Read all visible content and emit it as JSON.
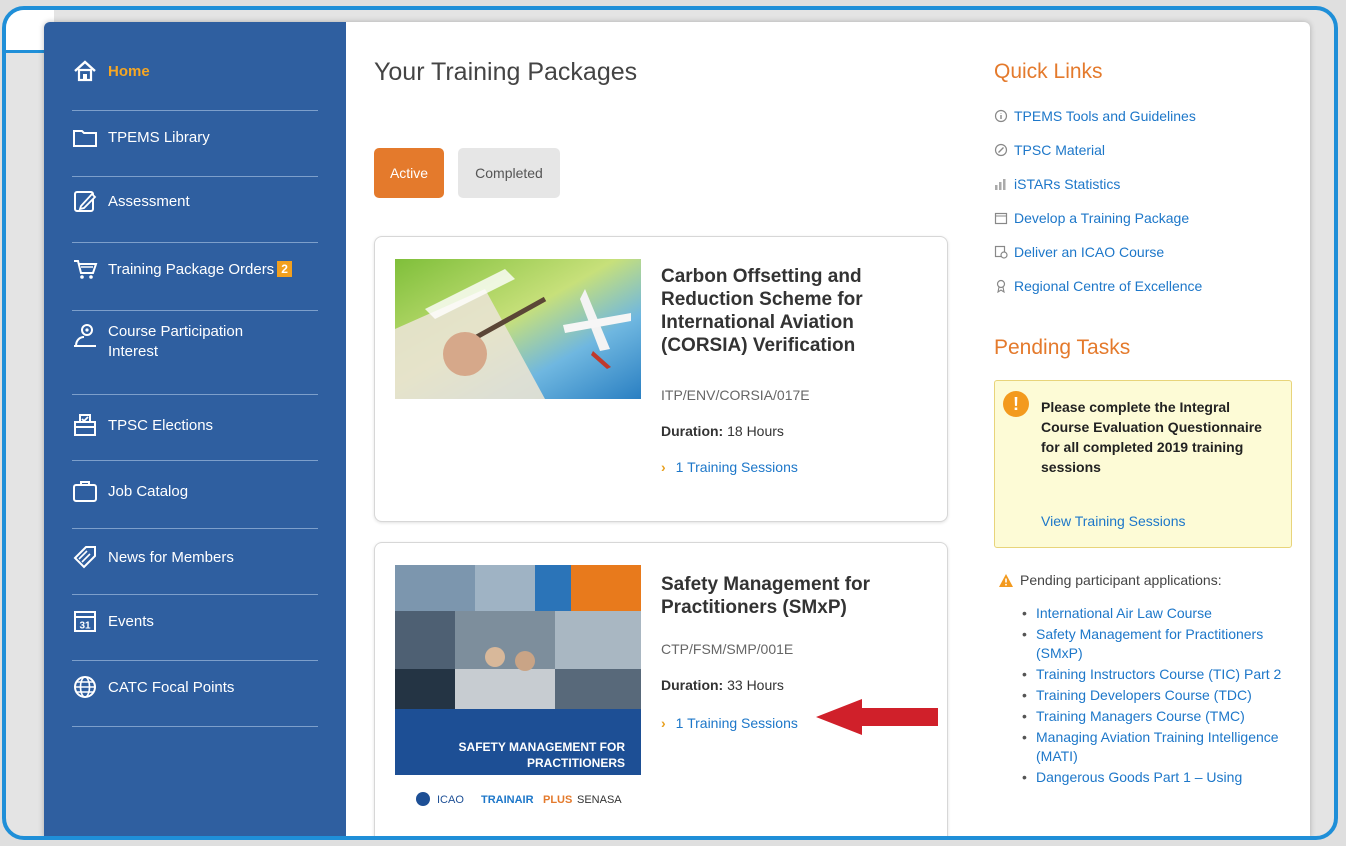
{
  "sidebar": {
    "items": [
      {
        "label": "Home",
        "icon": "home-icon"
      },
      {
        "label": "TPEMS Library",
        "icon": "folder-icon"
      },
      {
        "label": "Assessment",
        "icon": "edit-icon"
      },
      {
        "label": "Training Package Orders",
        "icon": "cart-icon",
        "badge": "2"
      },
      {
        "label": "Course Participation Interest",
        "icon": "person-location-icon"
      },
      {
        "label": "TPSC Elections",
        "icon": "ballot-icon"
      },
      {
        "label": "Job Catalog",
        "icon": "briefcase-icon"
      },
      {
        "label": "News for Members",
        "icon": "tag-icon"
      },
      {
        "label": "Events",
        "icon": "calendar-icon",
        "icon_text": "31"
      },
      {
        "label": "CATC Focal Points",
        "icon": "globe-icon"
      }
    ]
  },
  "main": {
    "title": "Your Training Packages",
    "tabs": [
      {
        "label": "Active",
        "active": true
      },
      {
        "label": "Completed",
        "active": false
      }
    ],
    "packages": [
      {
        "title": "Carbon Offsetting and Reduction Scheme for International Aviation (CORSIA) Verification",
        "code": "ITP/ENV/CORSIA/017E",
        "duration_label": "Duration:",
        "duration_value": "18 Hours",
        "sessions": "1 Training Sessions"
      },
      {
        "title": "Safety Management for Practitioners (SMxP)",
        "code": "CTP/FSM/SMP/001E",
        "duration_label": "Duration:",
        "duration_value": "33 Hours",
        "sessions": "1 Training Sessions",
        "image_banner": "SAFETY MANAGEMENT FOR PRACTITIONERS",
        "logos": {
          "icao": "ICAO",
          "trainair": "TRAINAIR",
          "plus": "PLUS",
          "senasa": "SENASA"
        }
      }
    ]
  },
  "quick_links": {
    "title": "Quick Links",
    "items": [
      {
        "label": "TPEMS Tools and Guidelines",
        "icon": "info-circle-icon"
      },
      {
        "label": "TPSC Material",
        "icon": "compass-icon"
      },
      {
        "label": "iSTARs Statistics",
        "icon": "bar-chart-icon"
      },
      {
        "label": "Develop a Training Package",
        "icon": "document-icon"
      },
      {
        "label": "Deliver an ICAO Course",
        "icon": "certificate-icon"
      },
      {
        "label": "Regional Centre of Excellence",
        "icon": "award-icon"
      }
    ]
  },
  "pending": {
    "title": "Pending Tasks",
    "notice_text": "Please complete the Integral Course Evaluation Questionnaire for all completed 2019 training sessions",
    "notice_link": "View Training Sessions",
    "applications_label": "Pending participant applications:",
    "applications": [
      "International Air Law Course",
      "Safety Management for Practitioners (SMxP)",
      "Training Instructors Course (TIC) Part 2",
      "Training Developers Course (TDC)",
      "Training Managers Course (TMC)",
      "Managing Aviation Training Intelligence (MATI)",
      "Dangerous Goods Part 1 – Using"
    ]
  },
  "colors": {
    "sidebar": "#2f5fa0",
    "accent_orange": "#e47a2c",
    "link_blue": "#1d77c9",
    "frame_blue": "#1f8fd8",
    "arrow_red": "#d0202a"
  }
}
